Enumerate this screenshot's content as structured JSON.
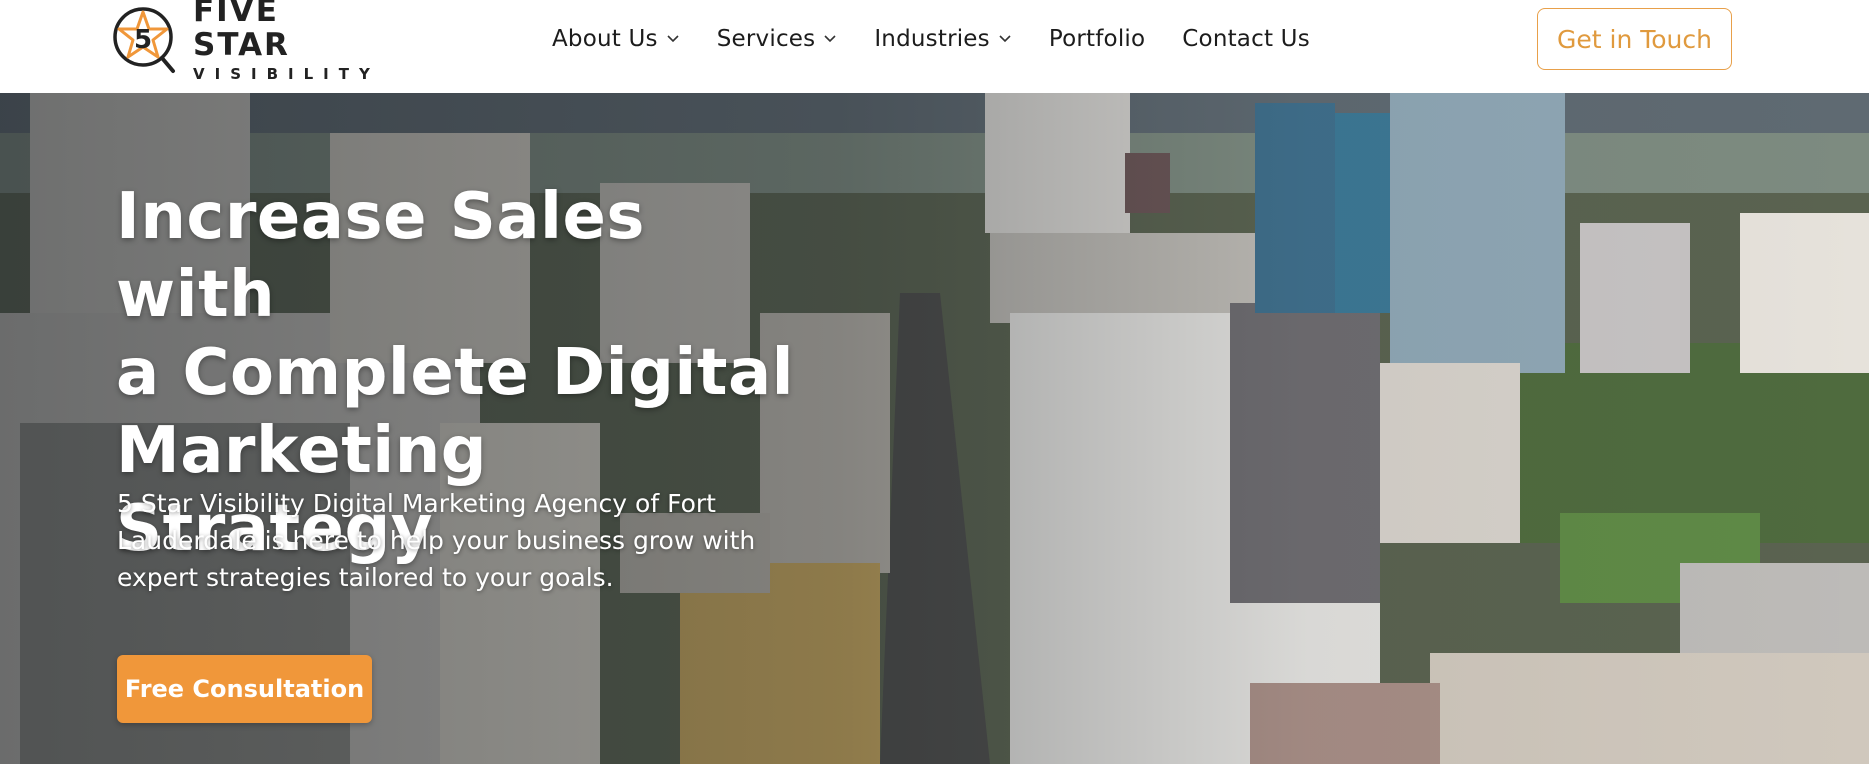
{
  "brand": {
    "logo_badge": "5",
    "name_line1": "FIVE STAR",
    "name_line2": "VISIBILITY",
    "accent_color": "#f0973a",
    "outline_color": "#e8a04a"
  },
  "nav": {
    "items": [
      {
        "label": "About Us",
        "has_dropdown": true
      },
      {
        "label": "Services",
        "has_dropdown": true
      },
      {
        "label": "Industries",
        "has_dropdown": true
      },
      {
        "label": "Portfolio",
        "has_dropdown": false
      },
      {
        "label": "Contact Us",
        "has_dropdown": false
      }
    ],
    "cta_label": "Get in Touch"
  },
  "hero": {
    "title_lines": [
      "Increase Sales with",
      "a Complete Digital",
      "Marketing Strategy"
    ],
    "subtitle_lines": [
      "5 Star Visibility Digital Marketing Agency of Fort",
      "Lauderdale is here to help your business grow with",
      "expert strategies tailored to your goals."
    ],
    "cta_label": "Free Consultation",
    "background": "aerial-city-skyline-image"
  },
  "icons": {
    "logo": "star-magnifier-logo-icon",
    "dropdown": "chevron-down-icon"
  }
}
